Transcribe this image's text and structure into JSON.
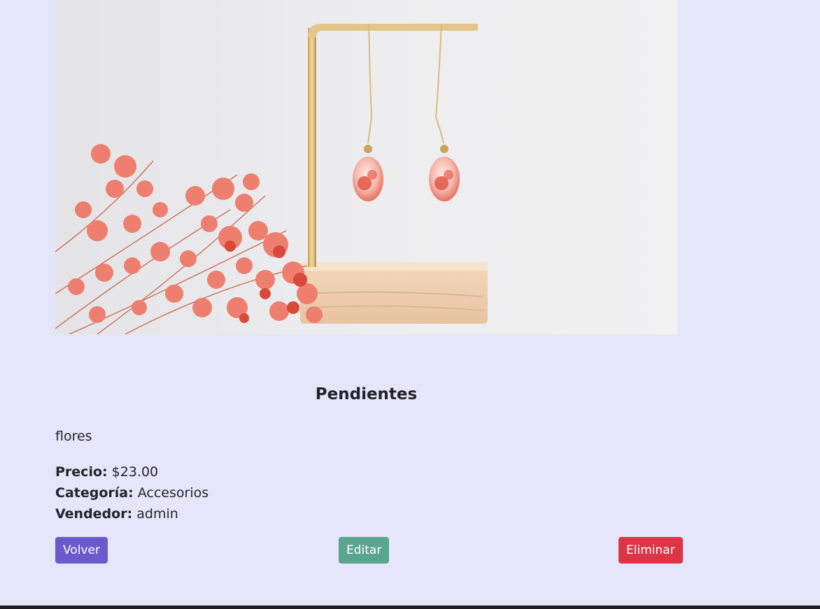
{
  "product": {
    "image_alt": "Pendientes",
    "title": "Pendientes",
    "description": "flores",
    "price_label": "Precio:",
    "price_value": "$23.00",
    "category_label": "Categoría:",
    "category_value": "Accesorios",
    "seller_label": "Vendedor:",
    "seller_value": "admin"
  },
  "actions": {
    "back_label": "Volver",
    "edit_label": "Editar",
    "delete_label": "Eliminar"
  },
  "colors": {
    "page_background": "#e6e6fa",
    "back_button": "#6a5acd",
    "edit_button": "#5aa58e",
    "delete_button": "#dc3545",
    "footer": "#1e1e1e"
  }
}
